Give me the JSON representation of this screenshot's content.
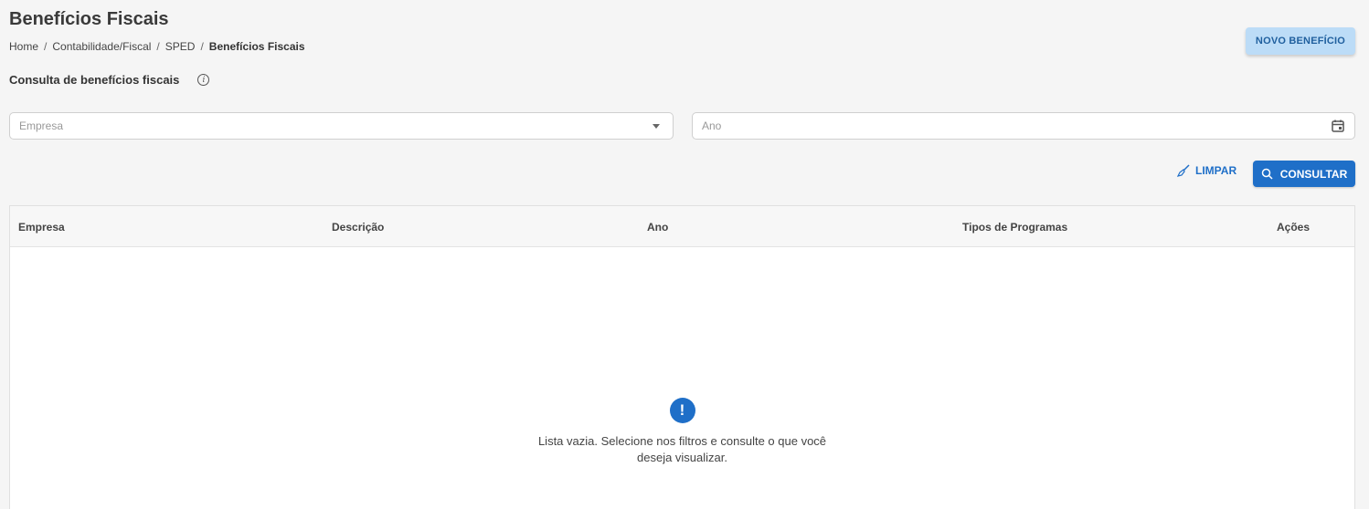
{
  "page": {
    "title": "Benefícios Fiscais",
    "breadcrumb": [
      "Home",
      "Contabilidade/Fiscal",
      "SPED",
      "Benefícios Fiscais"
    ],
    "new_button": "NOVO BENEFÍCIO"
  },
  "section": {
    "heading": "Consulta de benefícios fiscais",
    "info_icon": "info-icon"
  },
  "filters": {
    "empresa_placeholder": "Empresa",
    "ano_placeholder": "Ano",
    "clear_label": "LIMPAR",
    "consult_label": "CONSULTAR"
  },
  "table": {
    "columns": [
      "Empresa",
      "Descrição",
      "Ano",
      "Tipos de Programas",
      "Ações"
    ],
    "rows": [],
    "empty_message": "Lista vazia. Selecione nos filtros e consulte o que você deseja visualizar."
  },
  "colors": {
    "primary": "#1f6fc8",
    "secondary_button": "#bcdcf7",
    "background": "#f5f5f5"
  }
}
